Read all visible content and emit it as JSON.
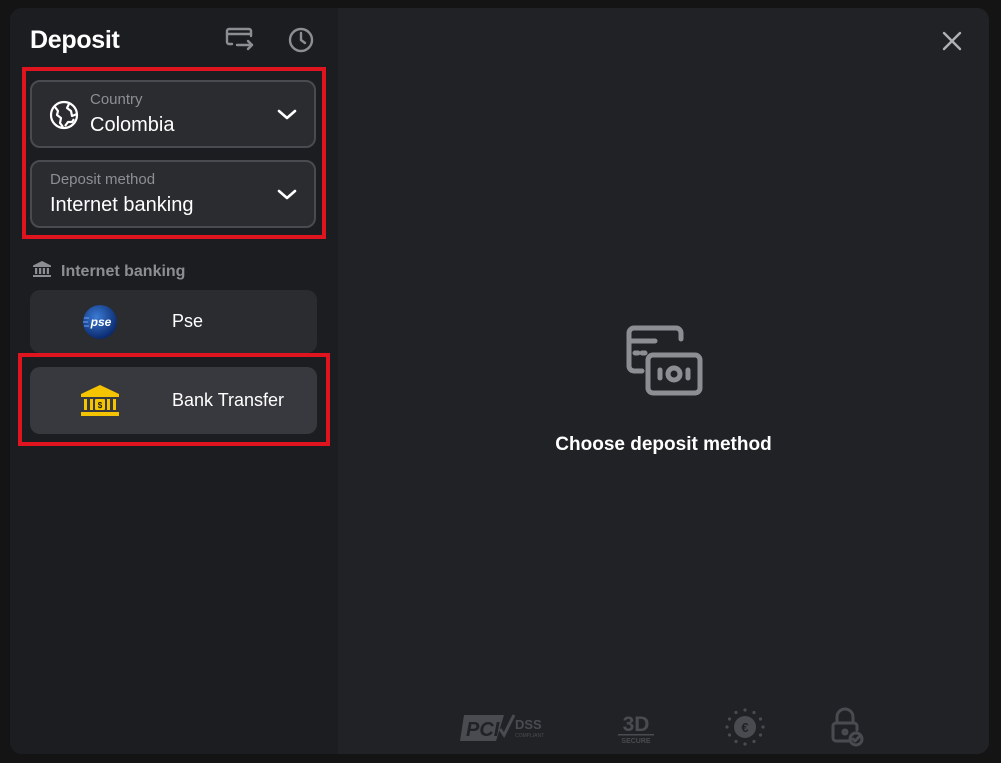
{
  "header": {
    "title": "Deposit",
    "transfer_icon": "card-transfer-icon",
    "history_icon": "clock-icon"
  },
  "country_select": {
    "label": "Country",
    "value": "Colombia",
    "icon": "globe-icon"
  },
  "method_select": {
    "label": "Deposit method",
    "value": "Internet banking"
  },
  "section": {
    "label": "Internet banking",
    "icon": "bank-icon"
  },
  "methods": [
    {
      "name": "Pse",
      "logo": "pse-logo"
    },
    {
      "name": "Bank Transfer",
      "logo": "bank-building-logo",
      "selected": true
    }
  ],
  "main": {
    "empty_icon": "card-cash-icon",
    "empty_text": "Choose deposit method",
    "close_icon": "close-icon"
  },
  "badges": [
    {
      "icon": "pci-dss-icon",
      "text_1": "PCI",
      "text_2": "DSS",
      "text_3": "COMPLIANT"
    },
    {
      "icon": "3d-secure-icon",
      "text_1": "3D",
      "text_2": "SECURE"
    },
    {
      "icon": "euro-stars-icon",
      "text_1": "€"
    },
    {
      "icon": "lock-check-icon"
    }
  ],
  "colors": {
    "modal_bg": "#212226",
    "sidebar_bg": "#1c1d20",
    "field_bg": "#2b2c30",
    "highlight_red": "#e0141e",
    "muted_text": "#8d8e93"
  }
}
